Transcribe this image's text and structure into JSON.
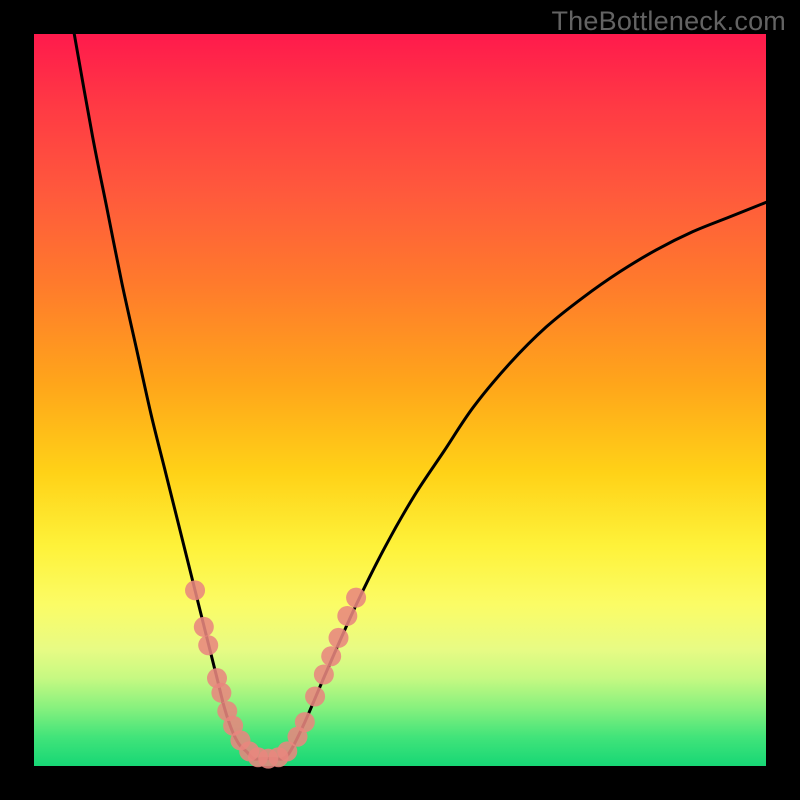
{
  "watermark": "TheBottleneck.com",
  "colors": {
    "frame": "#000000",
    "watermark": "#636363",
    "curve": "#000000",
    "dot": "#e8867e",
    "gradient_top": "#ff1a4c",
    "gradient_bottom": "#17d775"
  },
  "chart_data": {
    "type": "line",
    "title": "",
    "xlabel": "",
    "ylabel": "",
    "xlim": [
      0,
      100
    ],
    "ylim": [
      0,
      100
    ],
    "grid": false,
    "note": "No axis ticks or numeric labels are rendered in the image; x and y are in image-normalized percent coordinates (0 = left/bottom, 100 = right/top).",
    "series": [
      {
        "name": "left-branch",
        "x": [
          5.5,
          8,
          10,
          12,
          14,
          16,
          18,
          20,
          22,
          23.5,
          25,
          26,
          27,
          28,
          29
        ],
        "y": [
          100,
          86,
          76,
          66,
          57,
          48,
          40,
          32,
          24,
          18,
          12,
          8,
          5,
          3,
          2
        ]
      },
      {
        "name": "valley-floor",
        "x": [
          29,
          30,
          31,
          32,
          33,
          34,
          35
        ],
        "y": [
          2,
          1,
          1,
          1,
          1,
          1,
          2
        ]
      },
      {
        "name": "right-branch",
        "x": [
          35,
          37,
          40,
          44,
          48,
          52,
          56,
          60,
          65,
          70,
          75,
          80,
          85,
          90,
          95,
          100
        ],
        "y": [
          2,
          6,
          13,
          22,
          30,
          37,
          43,
          49,
          55,
          60,
          64,
          67.5,
          70.5,
          73,
          75,
          77
        ]
      }
    ],
    "scatter": {
      "name": "highlight-dots",
      "x": [
        22.0,
        23.2,
        23.8,
        25.0,
        25.6,
        26.4,
        27.2,
        28.2,
        29.4,
        30.6,
        32.0,
        33.4,
        34.6,
        36.0,
        37.0,
        38.4,
        39.6,
        40.6,
        41.6,
        42.8,
        44.0
      ],
      "y": [
        24.0,
        19.0,
        16.5,
        12.0,
        10.0,
        7.5,
        5.5,
        3.5,
        2.0,
        1.2,
        1.0,
        1.2,
        2.0,
        4.0,
        6.0,
        9.5,
        12.5,
        15.0,
        17.5,
        20.5,
        23.0
      ]
    }
  }
}
